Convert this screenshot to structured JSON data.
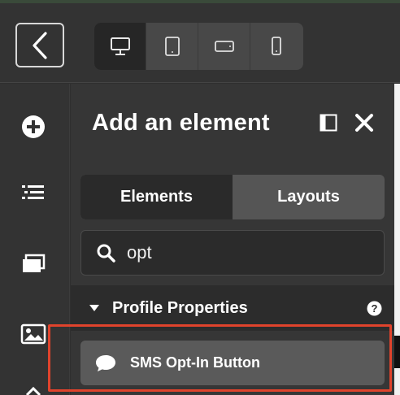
{
  "toolbar": {
    "back_icon": "chevron-left-icon",
    "devices": [
      {
        "icon": "desktop-icon",
        "active": true
      },
      {
        "icon": "tablet-icon",
        "active": false
      },
      {
        "icon": "tablet-landscape-icon",
        "active": false
      },
      {
        "icon": "phone-icon",
        "active": false
      }
    ]
  },
  "rail": {
    "icons": [
      "add-circle-icon",
      "list-icon",
      "layers-icon",
      "image-icon"
    ]
  },
  "panel": {
    "title": "Add an element",
    "tabs": [
      {
        "label": "Elements",
        "active": true
      },
      {
        "label": "Layouts",
        "active": false
      }
    ],
    "search": {
      "value": "opt",
      "icon": "search-icon"
    },
    "section": {
      "label": "Profile Properties",
      "expanded": true
    },
    "results": [
      {
        "label": "SMS Opt-In Button",
        "icon": "chat-bubble-icon"
      }
    ]
  },
  "colors": {
    "background": "#2f2f2f",
    "panel": "#363636",
    "highlight": "#e0432c"
  }
}
